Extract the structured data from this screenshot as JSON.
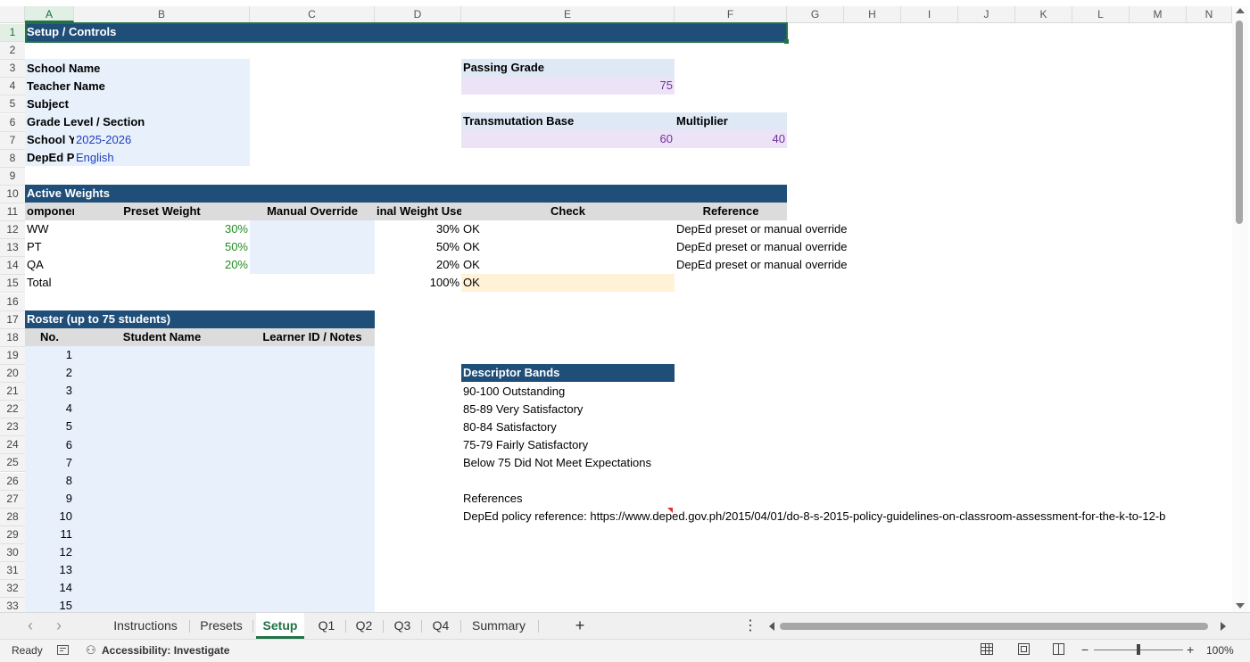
{
  "columns": [
    "A",
    "B",
    "C",
    "D",
    "E",
    "F",
    "G",
    "H",
    "I",
    "J",
    "K",
    "L",
    "M",
    "N"
  ],
  "rows": [
    "1",
    "2",
    "3",
    "4",
    "5",
    "6",
    "7",
    "8",
    "9",
    "10",
    "11",
    "12",
    "13",
    "14",
    "15",
    "16",
    "17",
    "18",
    "19",
    "20",
    "21",
    "22",
    "23",
    "24",
    "25",
    "26",
    "27",
    "28",
    "29",
    "30",
    "31",
    "32",
    "33"
  ],
  "selected": {
    "column": "A",
    "row": "1"
  },
  "setup": {
    "title": "Setup / Controls",
    "school_name_label": "School Name",
    "teacher_name_label": "Teacher Name",
    "subject_label": "Subject",
    "grade_label": "Grade Level / Section",
    "school_year_label": "School Y",
    "school_year_value": "2025-2026",
    "deped_label": "DepEd Pr",
    "deped_value": "English",
    "passing_grade_label": "Passing Grade",
    "passing_grade_value": "75",
    "transmutation_label": "Transmutation Base",
    "multiplier_label": "Multiplier",
    "transmutation_value": "60",
    "multiplier_value": "40"
  },
  "weights": {
    "title": "Active Weights",
    "headers": {
      "component": "omponer",
      "preset": "Preset Weight",
      "manual": "Manual Override",
      "final": "inal Weight Use",
      "check": "Check",
      "reference": "Reference"
    },
    "rows": [
      {
        "component": "WW",
        "preset": "30%",
        "final": "30%",
        "check": "OK",
        "reference": "DepEd preset or manual override"
      },
      {
        "component": "PT",
        "preset": "50%",
        "final": "50%",
        "check": "OK",
        "reference": "DepEd preset or manual override"
      },
      {
        "component": "QA",
        "preset": "20%",
        "final": "20%",
        "check": "OK",
        "reference": "DepEd preset or manual override"
      }
    ],
    "total": {
      "label": "Total",
      "final": "100%",
      "check": "OK"
    }
  },
  "roster": {
    "title": "Roster (up to 75 students)",
    "headers": {
      "no": "No.",
      "name": "Student Name",
      "id": "Learner ID / Notes"
    },
    "numbers": [
      "1",
      "2",
      "3",
      "4",
      "5",
      "6",
      "7",
      "8",
      "9",
      "10",
      "11",
      "12",
      "13",
      "14",
      "15"
    ]
  },
  "descriptors": {
    "title": "Descriptor Bands",
    "items": [
      "90-100 Outstanding",
      "85-89 Very Satisfactory",
      "80-84 Satisfactory",
      "75-79 Fairly Satisfactory",
      "Below 75 Did Not Meet Expectations"
    ],
    "references_label": "References",
    "reference_text": "DepEd policy reference: https://www.deped.gov.ph/2015/04/01/do-8-s-2015-policy-guidelines-on-classroom-assessment-for-the-k-to-12-b"
  },
  "tabs": {
    "items": [
      "Instructions",
      "Presets",
      "Setup",
      "Q1",
      "Q2",
      "Q3",
      "Q4",
      "Summary"
    ],
    "active": "Setup",
    "add": "+",
    "prev": "‹",
    "next": "›",
    "more": "⋮"
  },
  "status": {
    "ready": "Ready",
    "accessibility": "Accessibility: Investigate",
    "zoom": "100%",
    "minus": "−",
    "plus": "+"
  }
}
